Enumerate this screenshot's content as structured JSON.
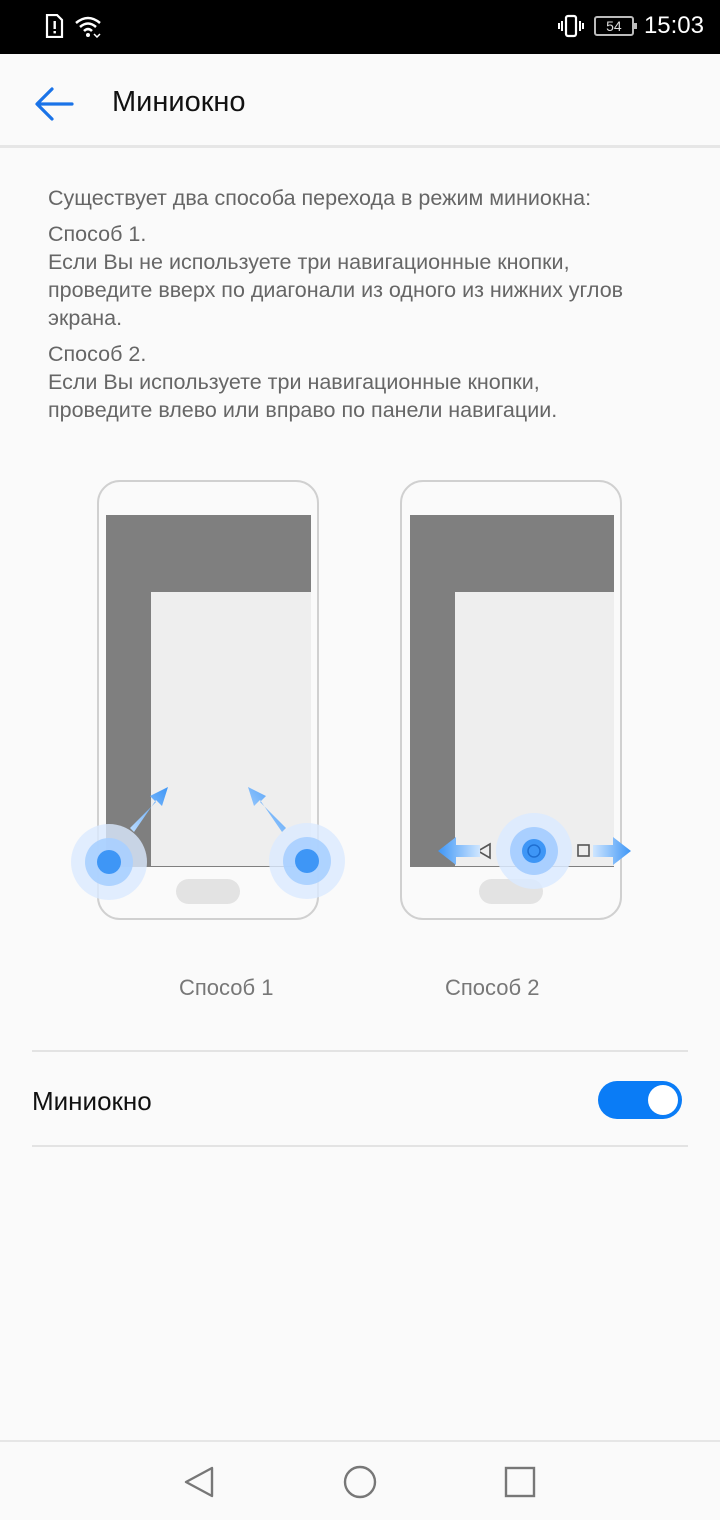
{
  "status_bar": {
    "icons": [
      "sim-alert-icon",
      "wifi-icon",
      "vibrate-icon",
      "battery-icon"
    ],
    "battery_level": "54",
    "time": "15:03"
  },
  "header": {
    "title": "Миниокно",
    "back_icon": "arrow-left-icon"
  },
  "intro": {
    "lead": "Существует два способа перехода в режим миниокна:",
    "method1_title": "Способ 1.",
    "method1_lines": [
      "Если Вы не используете три навигационные кнопки,",
      "проведите вверх по диагонали из одного из нижних углов",
      "экрана."
    ],
    "method2_title": "Способ 2.",
    "method2_lines": [
      "Если Вы используете три навигационные кнопки,",
      "проведите влево или вправо по панели навигации."
    ]
  },
  "illustrations": {
    "caption1": "Способ 1",
    "caption2": "Способ 2"
  },
  "setting": {
    "label": "Миниокно",
    "enabled": true,
    "accent": "#0a7cf6"
  },
  "nav_bar": {
    "icons": [
      "nav-back-icon",
      "nav-home-icon",
      "nav-recents-icon"
    ]
  }
}
